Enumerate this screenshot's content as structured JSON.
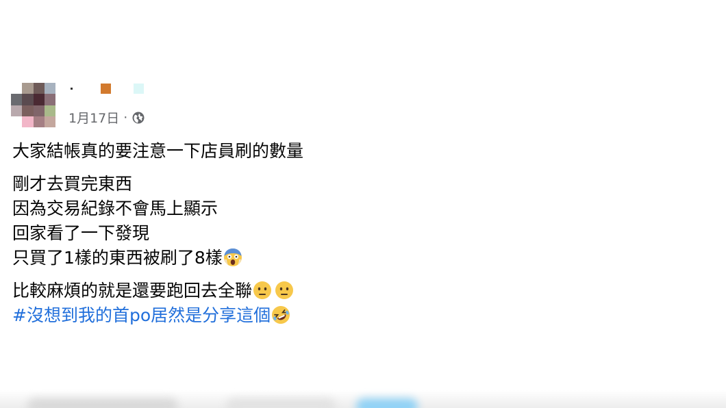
{
  "post": {
    "date": "1月17日",
    "separator": "·",
    "lines": [
      "大家結帳真的要注意一下店員刷的數量",
      "剛才去買完東西",
      "因為交易紀錄不會馬上顯示",
      "回家看了一下發現",
      "只買了1樣的東西被刷了8樣",
      "比較麻煩的就是還要跑回去全聯",
      "#沒想到我的首po居然是分享這個"
    ],
    "icons": {
      "privacy": "globe-icon",
      "emoji_scream": "scream-emoji-icon",
      "emoji_neutral": "neutral-face-emoji-icon",
      "emoji_rofl": "rofl-emoji-icon"
    },
    "colors": {
      "text": "#050505",
      "meta": "#65676b",
      "hashtag": "#216fdb"
    }
  }
}
